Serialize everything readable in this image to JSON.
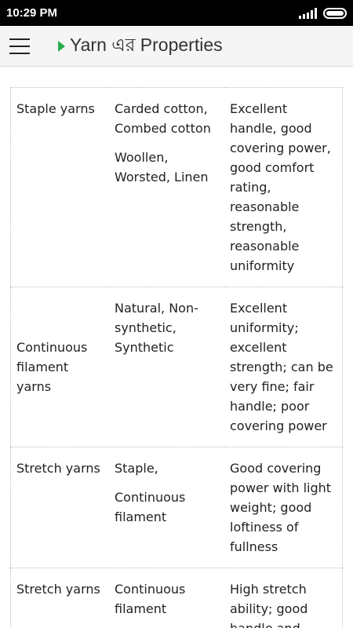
{
  "status_bar": {
    "time": "10:29 PM"
  },
  "app_bar": {
    "title": "Yarn এর Properties"
  },
  "table": {
    "rows": [
      {
        "type": "Staple yarns",
        "examples": [
          "Carded cotton, Combed cotton",
          "Woollen, Worsted, Linen"
        ],
        "properties": "Excellent handle, good covering power, good comfort rating, reasonable strength, reasonable uniformity"
      },
      {
        "type": "Continuous filament yarns",
        "examples": [
          "Natural, Non-synthetic, Synthetic"
        ],
        "properties": "Excellent uniformity; excellent strength; can be very fine; fair handle; poor covering power"
      },
      {
        "type": "Stretch yarns",
        "examples": [
          "Staple,",
          "Continuous filament"
        ],
        "properties": "Good covering power with light weight; good loftiness of fullness"
      },
      {
        "type": "Stretch yarns",
        "examples": [
          "Continuous filament"
        ],
        "properties": "High stretch ability; good handle and"
      }
    ]
  }
}
